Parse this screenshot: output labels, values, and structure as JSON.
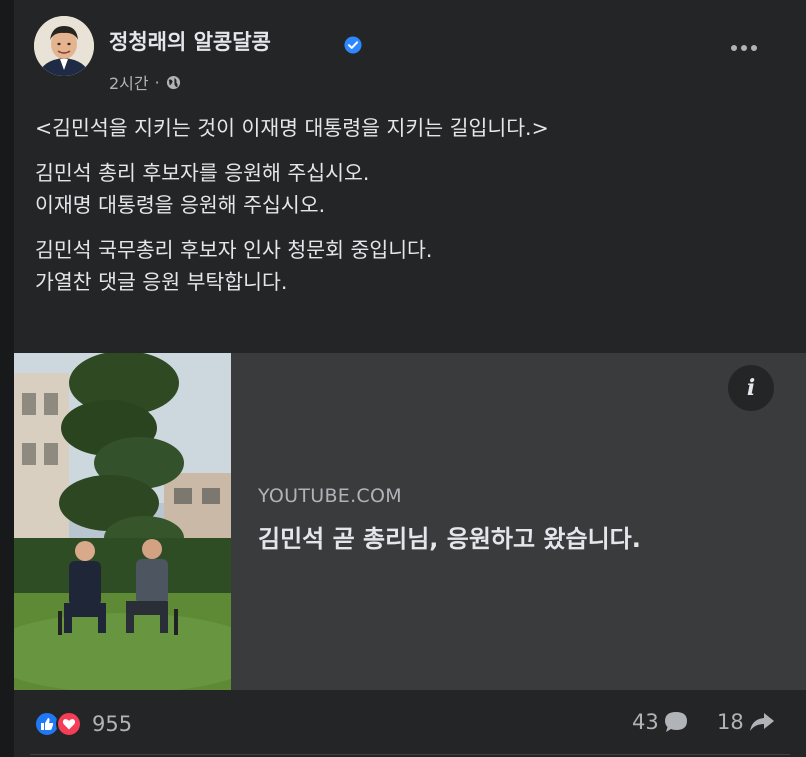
{
  "post": {
    "author": "정청래의 알콩달콩",
    "time": "2시간",
    "separator": "·",
    "paragraphs": [
      {
        "lines": [
          "<김민석을 지키는 것이 이재명 대통령을 지키는 길입니다.>"
        ]
      },
      {
        "lines": [
          "김민석 총리 후보자를 응원해 주십시오.",
          "이재명 대통령을 응원해 주십시오."
        ]
      },
      {
        "lines": [
          "김민석 국무총리 후보자 인사 청문회 중입니다.",
          "가열찬 댓글 응원 부탁합니다."
        ]
      }
    ]
  },
  "link": {
    "domain": "YOUTUBE.COM",
    "title": "김민석 곧 총리님, 응원하고 왔습니다.",
    "info_glyph": "i"
  },
  "stats": {
    "reactions": "955",
    "comments": "43",
    "shares": "18"
  },
  "colors": {
    "card_bg": "#242526",
    "preview_bg": "#3a3b3c",
    "verified": "#2d88ff",
    "like": "#2078f4",
    "love": "#f33e58"
  }
}
